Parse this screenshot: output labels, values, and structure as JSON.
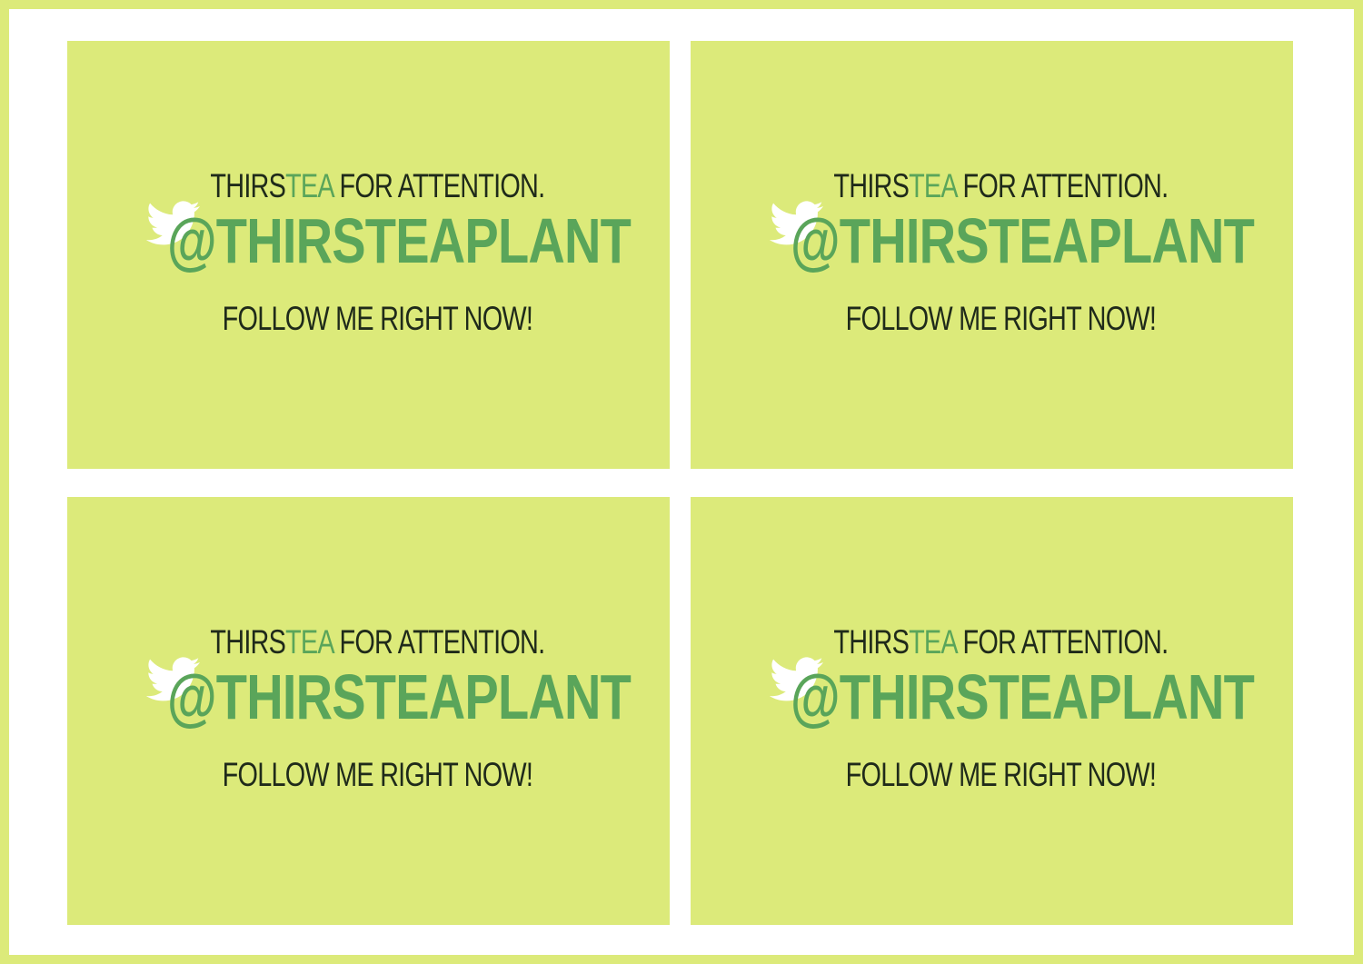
{
  "colors": {
    "background": "#dcea7a",
    "border": "#dcea7a",
    "accent_green": "#5aa55a",
    "text_dark": "#1f2a1a",
    "page": "#ffffff"
  },
  "cards": [
    {
      "line1_prefix": "THIRS",
      "line1_accent": "TEA",
      "line1_suffix": " FOR ATTENTION.",
      "icon": "twitter-bird-icon",
      "handle": "@THIRSTEAPLANT",
      "line3": "FOLLOW ME RIGHT NOW!"
    },
    {
      "line1_prefix": "THIRS",
      "line1_accent": "TEA",
      "line1_suffix": " FOR ATTENTION.",
      "icon": "twitter-bird-icon",
      "handle": "@THIRSTEAPLANT",
      "line3": "FOLLOW ME RIGHT NOW!"
    },
    {
      "line1_prefix": "THIRS",
      "line1_accent": "TEA",
      "line1_suffix": " FOR ATTENTION.",
      "icon": "twitter-bird-icon",
      "handle": "@THIRSTEAPLANT",
      "line3": "FOLLOW ME RIGHT NOW!"
    },
    {
      "line1_prefix": "THIRS",
      "line1_accent": "TEA",
      "line1_suffix": " FOR ATTENTION.",
      "icon": "twitter-bird-icon",
      "handle": "@THIRSTEAPLANT",
      "line3": "FOLLOW ME RIGHT NOW!"
    }
  ]
}
